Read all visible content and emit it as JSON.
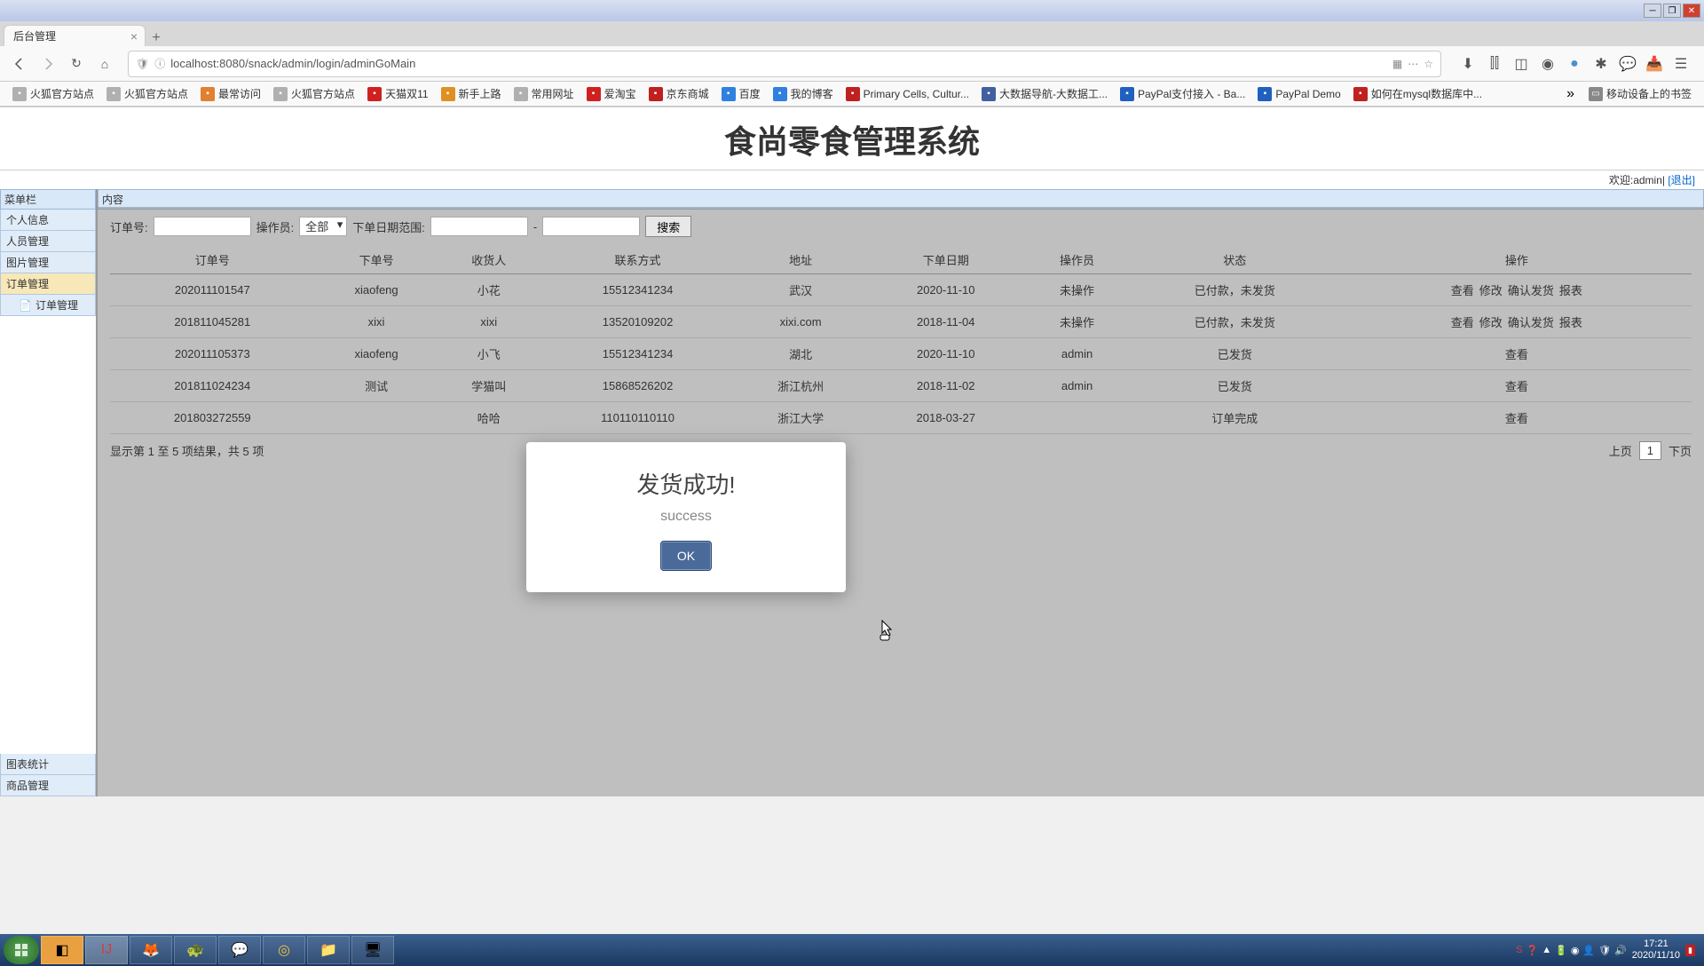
{
  "browser": {
    "tab_title": "后台管理",
    "url": "localhost:8080/snack/admin/login/adminGoMain",
    "bookmarks": [
      {
        "label": "火狐官方站点",
        "color": "#b0b0b0"
      },
      {
        "label": "火狐官方站点",
        "color": "#b0b0b0"
      },
      {
        "label": "最常访问",
        "color": "#e08030"
      },
      {
        "label": "火狐官方站点",
        "color": "#b0b0b0"
      },
      {
        "label": "天猫双11",
        "color": "#d02020"
      },
      {
        "label": "新手上路",
        "color": "#e09020"
      },
      {
        "label": "常用网址",
        "color": "#b0b0b0"
      },
      {
        "label": "爱淘宝",
        "color": "#d02020"
      },
      {
        "label": "京东商城",
        "color": "#c02020"
      },
      {
        "label": "百度",
        "color": "#3080e0"
      },
      {
        "label": "我的博客",
        "color": "#3080e0"
      },
      {
        "label": "Primary Cells, Cultur...",
        "color": "#c02020"
      },
      {
        "label": "大数据导航-大数据工...",
        "color": "#4060a0"
      },
      {
        "label": "PayPal支付接入 - Ba...",
        "color": "#2060c0"
      },
      {
        "label": "PayPal Demo",
        "color": "#2060c0"
      },
      {
        "label": "如何在mysql数据库中...",
        "color": "#c02020"
      }
    ],
    "more_bookmarks": "移动设备上的书签"
  },
  "page": {
    "title": "食尚零食管理系统",
    "welcome_prefix": "欢迎:",
    "welcome_user": "admin",
    "logout": "[退出]"
  },
  "sidebar": {
    "title": "菜单栏",
    "top_items": [
      "个人信息",
      "人员管理",
      "图片管理",
      "订单管理"
    ],
    "child": "订单管理",
    "bottom_items": [
      "图表统计",
      "商品管理"
    ]
  },
  "content": {
    "title": "内容",
    "filter": {
      "order_label": "订单号:",
      "operator_label": "操作员:",
      "operator_value": "全部",
      "date_label": "下单日期范围:",
      "date_sep": "-",
      "search": "搜索"
    },
    "columns": [
      "订单号",
      "下单号",
      "收货人",
      "联系方式",
      "地址",
      "下单日期",
      "操作员",
      "状态",
      "操作"
    ],
    "rows": [
      {
        "id": "202011101547",
        "user": "xiaofeng",
        "receiver": "小花",
        "phone": "15512341234",
        "addr": "武汉",
        "date": "2020-11-10",
        "op": "未操作",
        "status": "已付款，未发货",
        "actions": [
          "查看",
          "修改",
          "确认发货",
          "报表"
        ]
      },
      {
        "id": "201811045281",
        "user": "xixi",
        "receiver": "xixi",
        "phone": "13520109202",
        "addr": "xixi.com",
        "date": "2018-11-04",
        "op": "未操作",
        "status": "已付款，未发货",
        "actions": [
          "查看",
          "修改",
          "确认发货",
          "报表"
        ]
      },
      {
        "id": "202011105373",
        "user": "xiaofeng",
        "receiver": "小飞",
        "phone": "15512341234",
        "addr": "湖北",
        "date": "2020-11-10",
        "op": "admin",
        "status": "已发货",
        "actions": [
          "查看"
        ]
      },
      {
        "id": "201811024234",
        "user": "测试",
        "receiver": "学猫叫",
        "phone": "15868526202",
        "addr": "浙江杭州",
        "date": "2018-11-02",
        "op": "admin",
        "status": "已发货",
        "actions": [
          "查看"
        ]
      },
      {
        "id": "201803272559",
        "user": "",
        "receiver": "哈哈",
        "phone": "110110110110",
        "addr": "浙江大学",
        "date": "2018-03-27",
        "op": "",
        "status": "订单完成",
        "actions": [
          "查看"
        ]
      }
    ],
    "footer_info": "显示第 1 至 5 项结果，共 5 项",
    "prev": "上页",
    "page_num": "1",
    "next": "下页"
  },
  "modal": {
    "title": "发货成功!",
    "subtitle": "success",
    "ok": "OK"
  },
  "taskbar": {
    "time": "17:21",
    "date": "2020/11/10"
  }
}
